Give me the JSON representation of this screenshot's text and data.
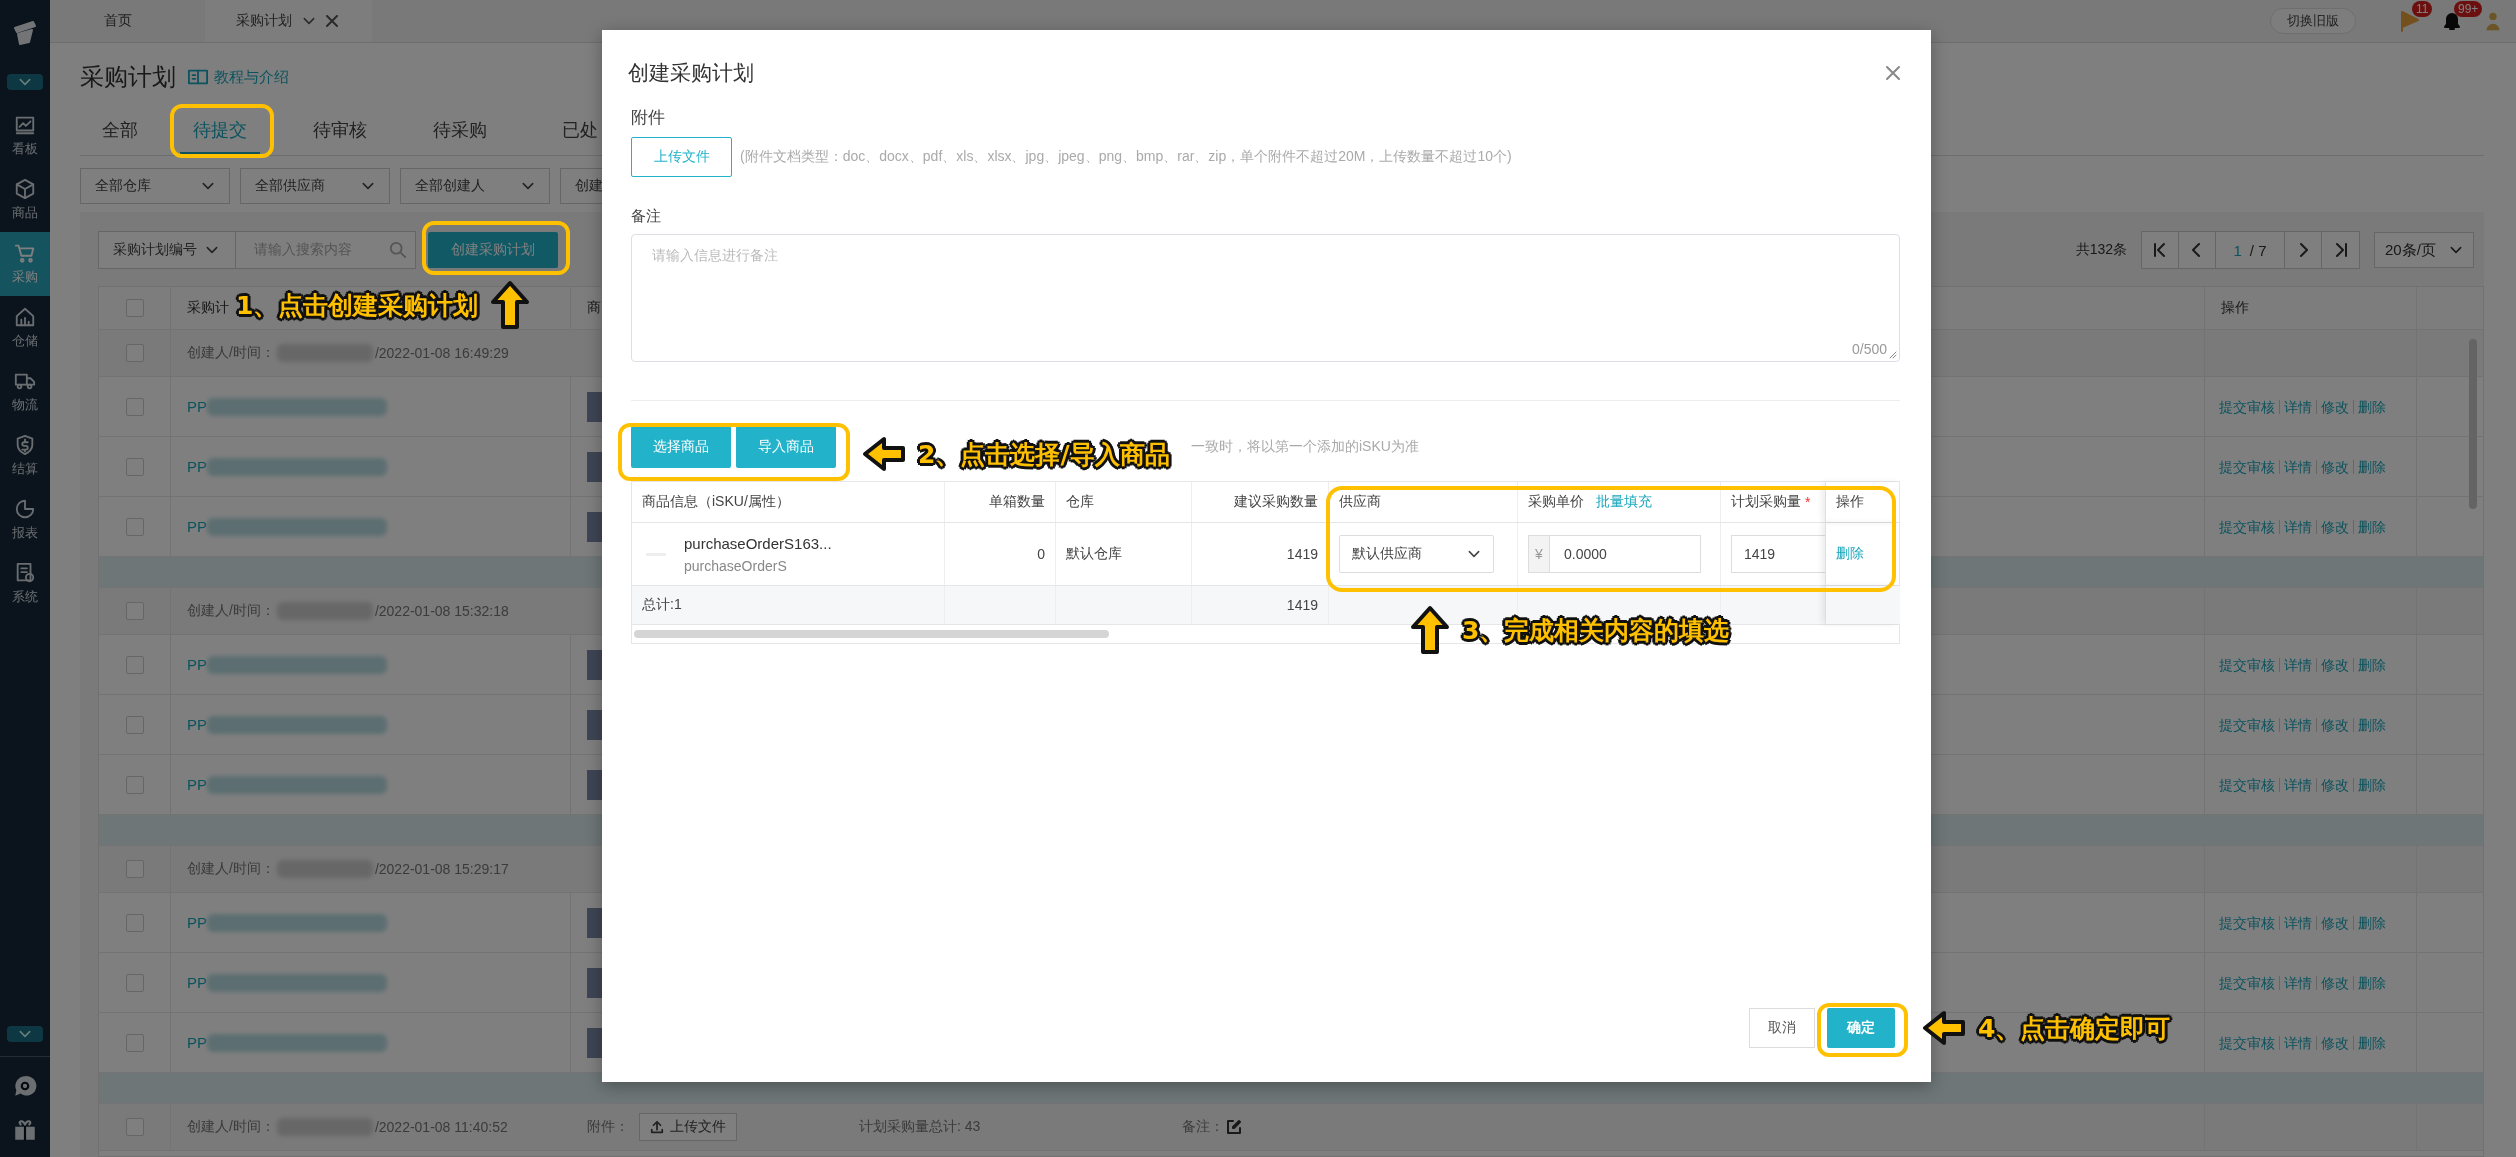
{
  "sidebar": {
    "menu": [
      {
        "kind": "board",
        "label": "看板",
        "selected": false
      },
      {
        "kind": "box",
        "label": "商品",
        "selected": false
      },
      {
        "kind": "cart",
        "label": "采购",
        "selected": true
      },
      {
        "kind": "house",
        "label": "仓储",
        "selected": false
      },
      {
        "kind": "truck",
        "label": "物流",
        "selected": false
      },
      {
        "kind": "money",
        "label": "结算",
        "selected": false
      },
      {
        "kind": "pie",
        "label": "报表",
        "selected": false
      },
      {
        "kind": "doc",
        "label": "系统",
        "selected": false
      }
    ]
  },
  "top_tabs": [
    {
      "label": "首页",
      "selected": false,
      "closable": false
    },
    {
      "label": "采购计划",
      "selected": true,
      "closable": true
    }
  ],
  "header_right": {
    "switch_button": "切换旧版",
    "flag_badge": "11",
    "bell_badge": "99+"
  },
  "page": {
    "title": "采购计划",
    "help_link": "教程与介绍",
    "tabs": [
      {
        "label": "全部",
        "selected": false
      },
      {
        "label": "待提交",
        "selected": true
      },
      {
        "label": "待审核",
        "selected": false
      },
      {
        "label": "待采购",
        "selected": false
      },
      {
        "label": "已处",
        "selected": false
      }
    ],
    "filters": [
      "全部仓库",
      "全部供应商",
      "全部创建人",
      "创建"
    ],
    "search": {
      "field": "采购计划编号",
      "placeholder": "请输入搜索内容"
    },
    "create_button": "创建采购计划",
    "pagination": {
      "total": "共132条",
      "page": "1",
      "pages": "/ 7",
      "page_size": "20条/页"
    },
    "table": {
      "columns": [
        "采购计",
        "商",
        "操作"
      ],
      "groups": [
        {
          "creator_label": "创建人/时间：",
          "time": "/2022-01-08 16:49:29",
          "checked": false,
          "rows": [
            {
              "prefix": "PP",
              "checked": false,
              "actions": [
                "提交审核",
                "详情",
                "修改",
                "删除"
              ]
            },
            {
              "prefix": "PP",
              "checked": false,
              "actions": [
                "提交审核",
                "详情",
                "修改",
                "删除"
              ]
            },
            {
              "prefix": "PP",
              "checked": false,
              "actions": [
                "提交审核",
                "详情",
                "修改",
                "删除"
              ]
            }
          ]
        },
        {
          "creator_label": "创建人/时间：",
          "time": "/2022-01-08 15:32:18",
          "checked": false,
          "rows": [
            {
              "prefix": "PP",
              "checked": false,
              "actions": [
                "提交审核",
                "详情",
                "修改",
                "删除"
              ]
            },
            {
              "prefix": "PP",
              "checked": false,
              "actions": [
                "提交审核",
                "详情",
                "修改",
                "删除"
              ]
            },
            {
              "prefix": "PP",
              "checked": false,
              "actions": [
                "提交审核",
                "详情",
                "修改",
                "删除"
              ]
            }
          ]
        },
        {
          "creator_label": "创建人/时间：",
          "time": "/2022-01-08 15:29:17",
          "checked": false,
          "rows": [
            {
              "prefix": "PP",
              "checked": false,
              "actions": [
                "提交审核",
                "详情",
                "修改",
                "删除"
              ]
            },
            {
              "prefix": "PP",
              "checked": false,
              "actions": [
                "提交审核",
                "详情",
                "修改",
                "删除"
              ]
            },
            {
              "prefix": "PP",
              "checked": false,
              "actions": [
                "提交审核",
                "详情",
                "修改",
                "删除"
              ]
            }
          ]
        },
        {
          "creator_label": "创建人/时间：",
          "time": "/2022-01-08 11:40:52",
          "checked": false,
          "attachment_label": "附件：",
          "upload_button": "上传文件",
          "total_label": "计划采购量总计: 43",
          "remark_label": "备注："
        }
      ],
      "select_all_checked": false
    }
  },
  "modal": {
    "title": "创建采购计划",
    "attachment": {
      "label": "附件",
      "upload_button": "上传文件",
      "hint": "(附件文档类型：doc、docx、pdf、xls、xlsx、jpg、jpeg、png、bmp、rar、zip，单个附件不超过20M，上传数量不超过10个)"
    },
    "remark": {
      "label": "备注",
      "placeholder": "请输入信息进行备注",
      "counter": "0/500"
    },
    "product_buttons": [
      "选择商品",
      "导入商品"
    ],
    "product_hint": "一致时，将以第一个添加的iSKU为准",
    "table": {
      "columns": [
        {
          "label": "商品信息（iSKU/属性）"
        },
        {
          "label": "单箱数量"
        },
        {
          "label": "仓库"
        },
        {
          "label": "建议采购数量"
        },
        {
          "label": "供应商"
        },
        {
          "label": "采购单价",
          "link": "批量填充"
        },
        {
          "label": "计划采购量",
          "required_mark": "*"
        },
        {
          "label": "操作"
        }
      ],
      "rows": [
        {
          "name": "purchaseOrderS163...",
          "sub": "purchaseOrderS",
          "box_qty": "0",
          "warehouse": "默认仓库",
          "suggested": "1419",
          "supplier": "默认供应商",
          "currency": "¥",
          "price": "0.0000",
          "plan_qty": "1419",
          "action": "删除"
        }
      ],
      "total": {
        "label": "总计:1",
        "suggested": "1419"
      }
    },
    "footer": {
      "cancel": "取消",
      "confirm": "确定"
    }
  },
  "annotations": [
    {
      "text": "1、点击创建采购计划",
      "kind": "up"
    },
    {
      "text": "2、点击选择/导入商品",
      "kind": "left"
    },
    {
      "text": "3、完成相关内容的填选",
      "kind": "up"
    },
    {
      "text": "4、点击确定即可",
      "kind": "left"
    }
  ]
}
